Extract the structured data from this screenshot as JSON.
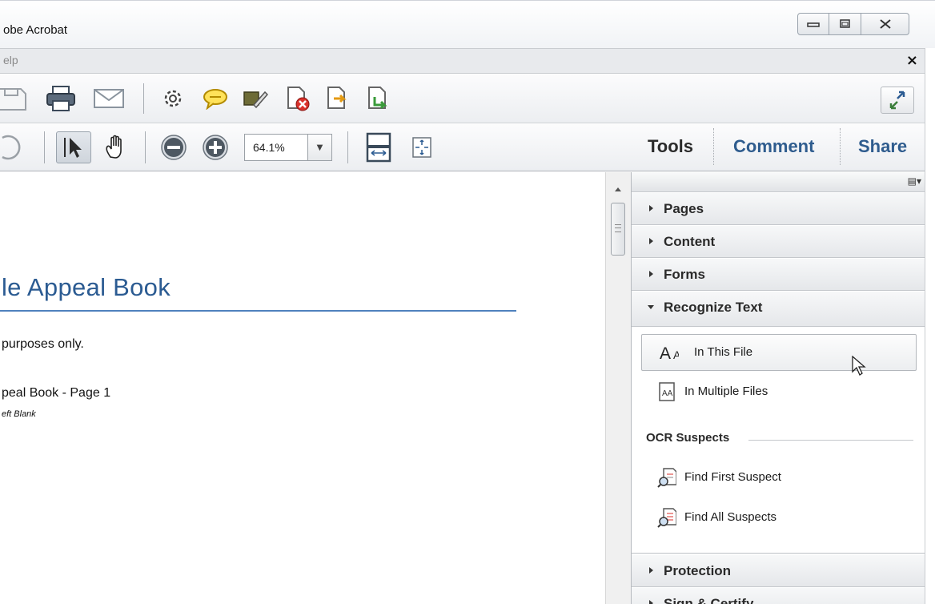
{
  "window": {
    "title": "obe Acrobat",
    "controls": [
      "minimize",
      "restore",
      "close"
    ]
  },
  "menubar": {
    "help_label": "elp",
    "close_glyph": "×"
  },
  "toolbar": {
    "zoom_value": "64.1%",
    "zoom_dropdown_glyph": "▼",
    "pane_tabs": [
      {
        "label": "Tools",
        "color": "#2b2b2b"
      },
      {
        "label": "Comment",
        "color": "#2f5c8e"
      },
      {
        "label": "Share",
        "color": "#2f5c8e"
      }
    ]
  },
  "document": {
    "title": "le Appeal Book",
    "line1": "purposes only.",
    "line2": "peal Book - Page 1",
    "line3": "eft Blank",
    "title_color": "#2b5b92",
    "rule_color": "#4f81bd"
  },
  "right_pane": {
    "options_glyph": "▤▾",
    "sections": [
      {
        "label": "Pages",
        "expanded": false
      },
      {
        "label": "Content",
        "expanded": false
      },
      {
        "label": "Forms",
        "expanded": false
      },
      {
        "label": "Recognize Text",
        "expanded": true
      },
      {
        "label": "Protection",
        "expanded": false
      },
      {
        "label": "Sign & Certify",
        "expanded": false
      }
    ],
    "recognize_text": {
      "items": [
        {
          "label": "In This File",
          "icon": "text-aa-icon",
          "selected": true
        },
        {
          "label": "In Multiple Files",
          "icon": "multiple-files-icon",
          "selected": false
        }
      ],
      "ocr_heading": "OCR Suspects",
      "ocr_items": [
        {
          "label": "Find First Suspect",
          "icon": "find-suspect-icon"
        },
        {
          "label": "Find All Suspects",
          "icon": "find-all-suspects-icon"
        }
      ]
    }
  }
}
